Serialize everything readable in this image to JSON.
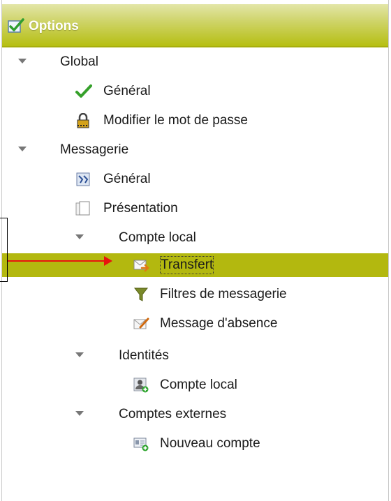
{
  "header": {
    "title": "Options",
    "icon": "checkbox-icon"
  },
  "tree": {
    "global": {
      "label": "Global",
      "items": [
        {
          "label": "Général",
          "icon": "checkmark-icon"
        },
        {
          "label": "Modifier le mot de passe",
          "icon": "padlock-icon"
        }
      ]
    },
    "messagerie": {
      "label": "Messagerie",
      "items": [
        {
          "label": "Général",
          "icon": "settings-icon"
        },
        {
          "label": "Présentation",
          "icon": "pages-icon"
        }
      ],
      "compte_local": {
        "label": "Compte local",
        "items": [
          {
            "label": "Transfert",
            "icon": "mail-forward-icon",
            "selected": true
          },
          {
            "label": "Filtres de messagerie",
            "icon": "filter-icon"
          },
          {
            "label": "Message d'absence",
            "icon": "mail-edit-icon"
          }
        ]
      },
      "identites": {
        "label": "Identités",
        "items": [
          {
            "label": "Compte local",
            "icon": "user-add-icon"
          }
        ]
      },
      "comptes_externes": {
        "label": "Comptes externes",
        "items": [
          {
            "label": "Nouveau compte",
            "icon": "card-add-icon"
          }
        ]
      }
    }
  },
  "colors": {
    "header": "#b6bf12",
    "selected_row": "#b3b80f",
    "annotation_arrow": "#e8140e"
  }
}
